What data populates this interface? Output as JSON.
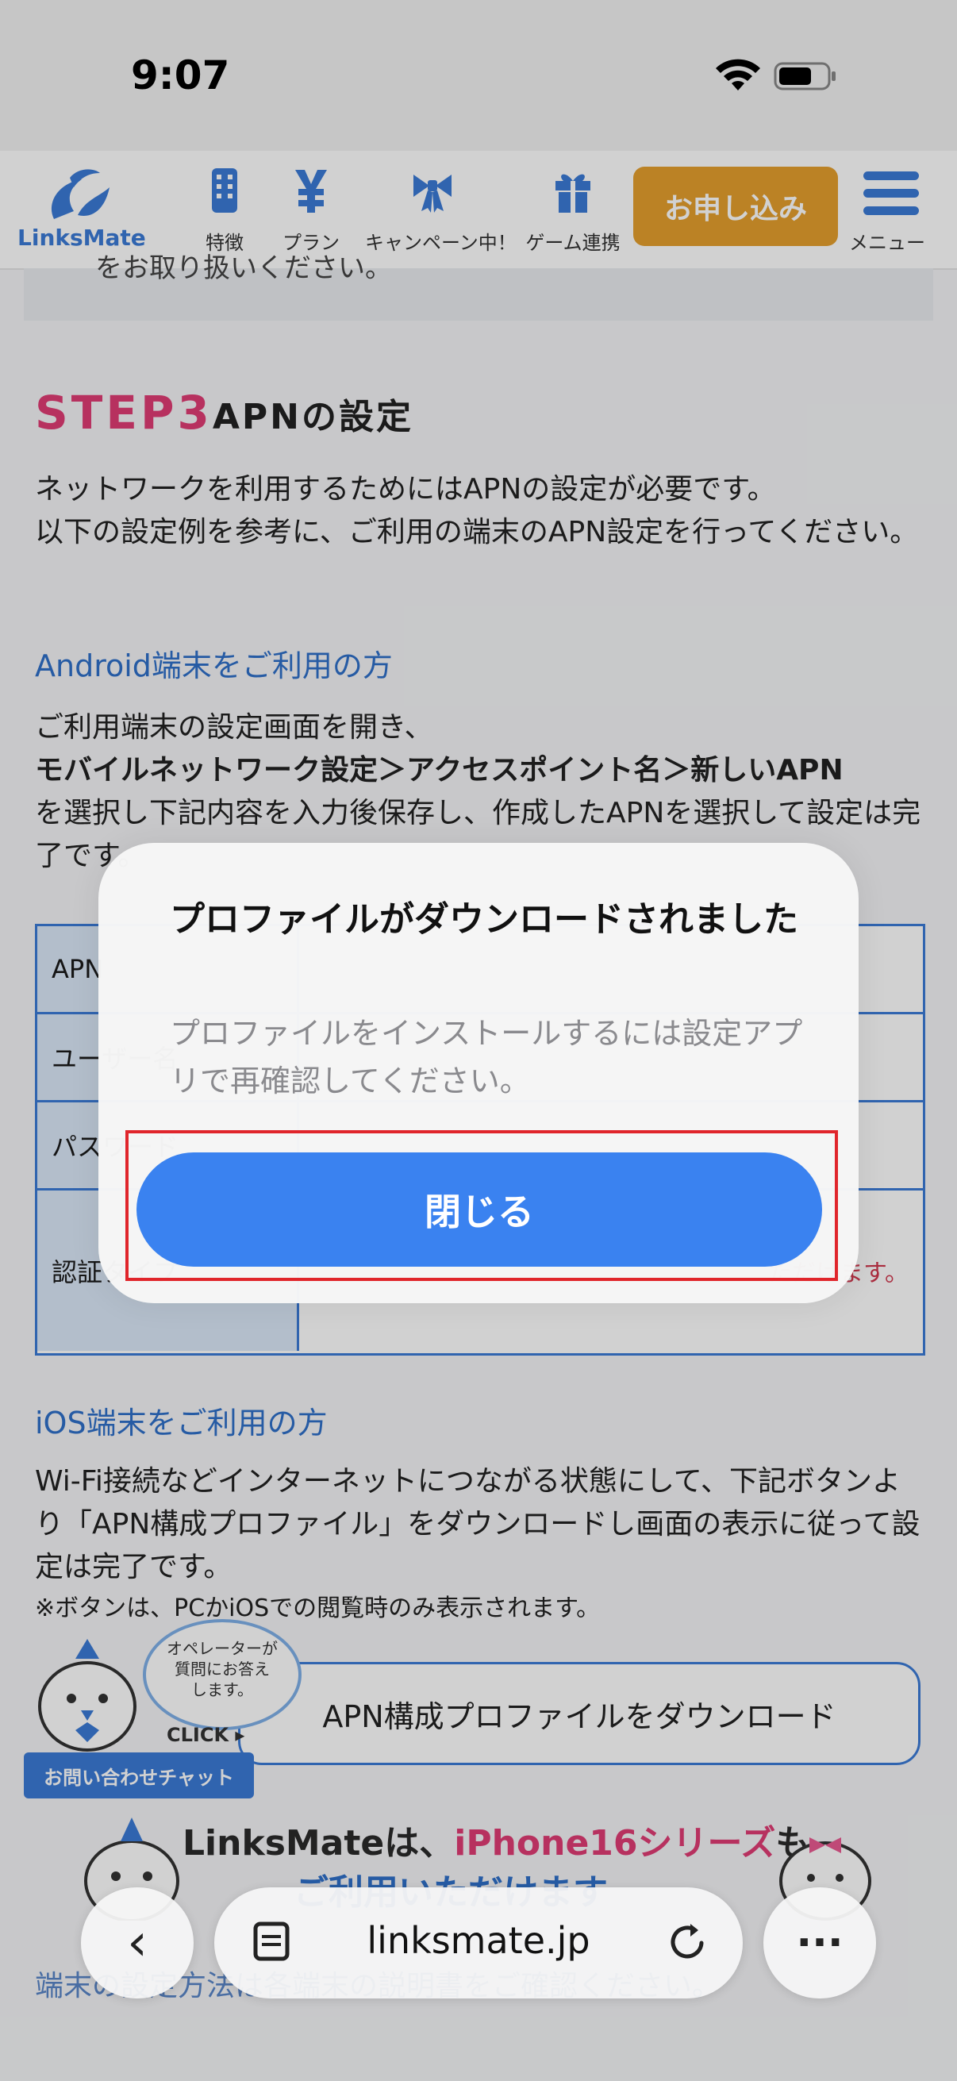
{
  "status_bar": {
    "time": "9:07"
  },
  "header": {
    "logo_text": "LinksMate",
    "nav": [
      {
        "label": "特徴",
        "icon": "building-icon"
      },
      {
        "label": "プラン",
        "icon": "yen-icon"
      },
      {
        "label": "キャンペーン中！",
        "icon": "ribbon-icon"
      },
      {
        "label": "ゲーム連携",
        "icon": "gift-icon"
      }
    ],
    "apply_label": "お申し込み",
    "menu_label": "メニュー"
  },
  "content": {
    "note_partial": "をお取り扱いください。",
    "step_num": "STEP3",
    "step_title": "APNの設定",
    "intro_1": "ネットワークを利用するためにはAPNの設定が必要です。",
    "intro_2": "以下の設定例を参考に、ご利用の端末のAPN設定を行ってください。",
    "android_heading": "Android端末をご利用の方",
    "android_1": "ご利用端末の設定画面を開き、",
    "android_2": "モバイルネットワーク設定＞アクセスポイント名＞新しいAPN",
    "android_3": "を選択し下記内容を入力後保存し、作成したAPNを選択して設定は完了です。",
    "table": [
      {
        "h": "APN",
        "v": ""
      },
      {
        "h": "ユーザー名",
        "v": ""
      },
      {
        "h": "パスワード",
        "v": ""
      },
      {
        "h": "認証タイプ",
        "v": "…ただけます。"
      }
    ],
    "ios_heading": "iOS端末をご利用の方",
    "ios_1": "Wi-Fi接続などインターネットにつながる状態にして、下記ボタンより「APN構成プロファイル」をダウンロードし画面の表示に従って設定は完了です。",
    "ios_note": "※ボタンは、PCかiOSでの閲覧時のみ表示されます。",
    "download_button": "APN構成プロファイルをダウンロード",
    "chat_bubble": "オペレーターが\n質問にお答え\nします。",
    "chat_click": "CLICK ▸",
    "chat_bar": "お問い合わせチャット",
    "banner_1": "LinksMateは、",
    "banner_pink": "iPhone16シリーズ",
    "banner_2": "も",
    "banner_sub": "ご利用いただけます",
    "bottom_text": "端末の設定方法は各端末の説明書をご確認ください。"
  },
  "alert": {
    "title": "プロファイルがダウンロードされました",
    "message": "プロファイルをインストールするには設定アプリで再確認してください。",
    "close_button": "閉じる"
  },
  "toolbar": {
    "back": "‹",
    "url": "linksmate.jp",
    "more": "···"
  }
}
